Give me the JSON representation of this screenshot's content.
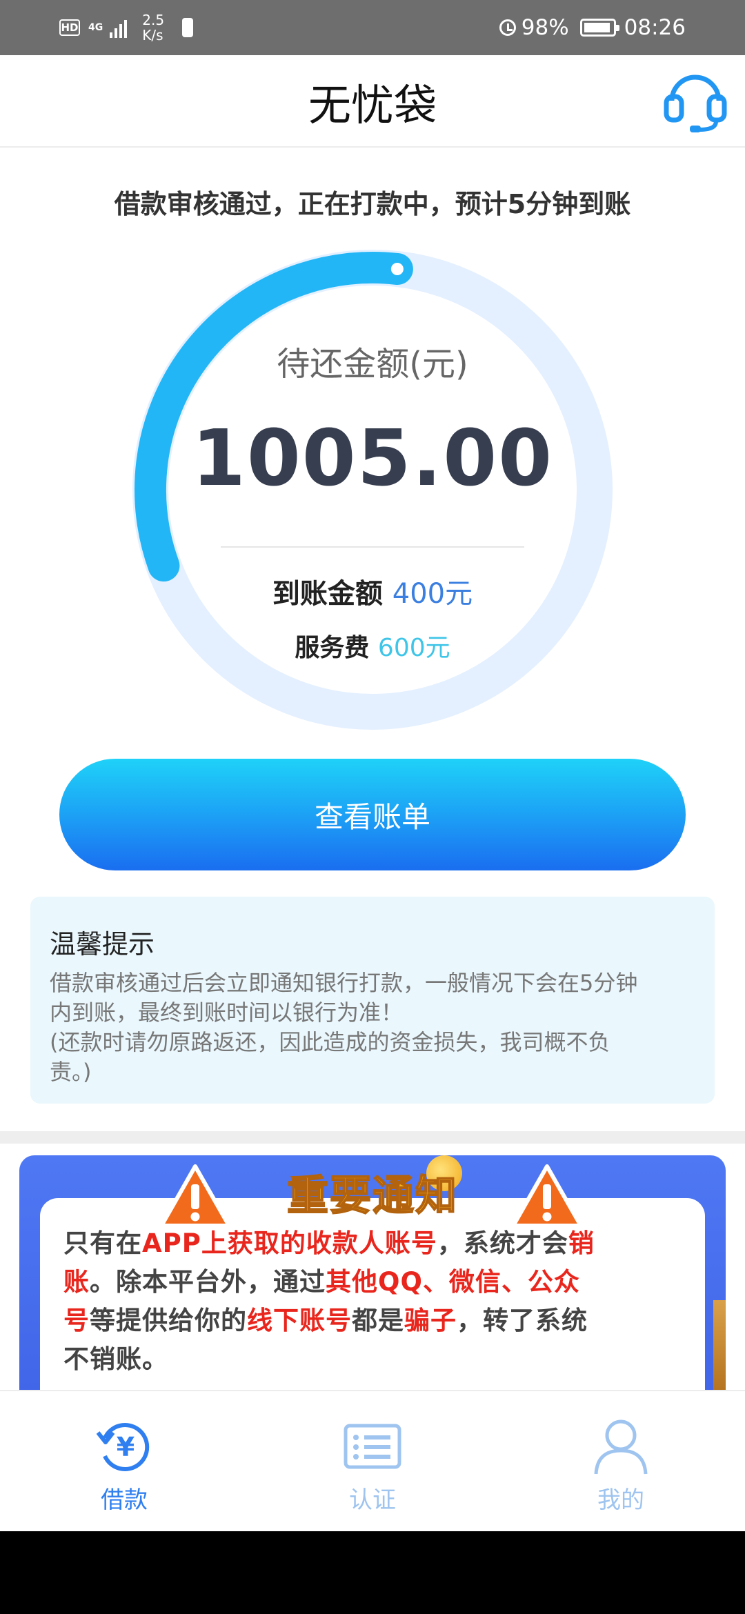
{
  "status_bar": {
    "hd": "HD",
    "network": "4G",
    "speed_value": "2.5",
    "speed_unit": "K/s",
    "battery_pct": "98%",
    "time": "08:26"
  },
  "header": {
    "title": "无忧袋",
    "cs_icon": "headset-icon"
  },
  "loan_status": {
    "message": "借款审核通过，正在打款中，预计5分钟到账",
    "due_label": "待还金额(元)",
    "due_amount": "1005.00",
    "arrival_label": "到账金额",
    "arrival_value": "400元",
    "fee_label": "服务费",
    "fee_value": "600元",
    "progress_fraction": 0.2
  },
  "actions": {
    "view_bill": "查看账单"
  },
  "tips": {
    "title": "温馨提示",
    "lines": [
      "借款审核通过后会立即通知银行打款，一般情况下会在5分钟",
      "内到账，最终到账时间以银行为准！",
      "(还款时请勿原路返还，因此造成的资金损失，我司概不负",
      "责。)"
    ]
  },
  "notice": {
    "title": "重要通知",
    "l1_a": "只有在",
    "l1_b": "APP上获取的收款人账号",
    "l1_c": "，系统才会",
    "l1_d": "销",
    "l2_a": "账",
    "l2_b": "。除本平台外，通过",
    "l2_c": "其他QQ、微信、公众",
    "l3_a": "号",
    "l3_b": "等提供给你的",
    "l3_c": "线下账号",
    "l3_d": "都是",
    "l3_e": "骗子",
    "l3_f": "，转了系统",
    "l4": "不销账。"
  },
  "tabbar": {
    "items": [
      {
        "label": "借款",
        "icon": "yen-cycle-icon",
        "active": true
      },
      {
        "label": "认证",
        "icon": "list-card-icon",
        "active": false
      },
      {
        "label": "我的",
        "icon": "user-icon",
        "active": false
      }
    ]
  },
  "colors": {
    "accent": "#2f7ff0",
    "arrival_value": "#3b7fe0",
    "fee_value": "#3fc5e8",
    "notice_red": "#e9261d"
  }
}
